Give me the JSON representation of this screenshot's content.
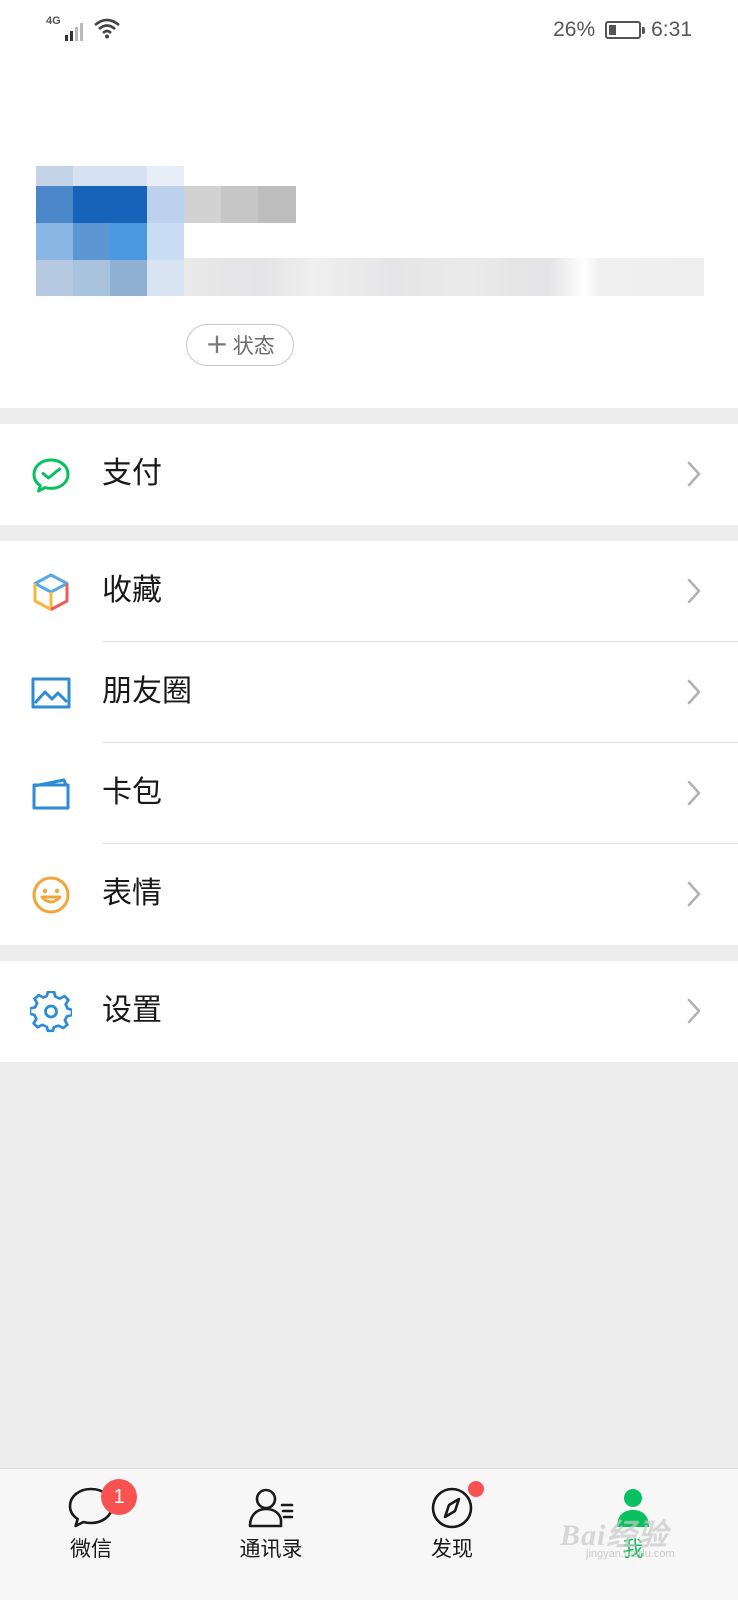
{
  "status_bar": {
    "network": "4G",
    "battery_percent": "26%",
    "battery_level": 0.26,
    "time": "6:31"
  },
  "profile": {
    "status_button_label": "状态",
    "status_button_plus": "+"
  },
  "menu": {
    "pay": {
      "label": "支付",
      "icon": "wechat-pay-icon"
    },
    "favorites": {
      "label": "收藏",
      "icon": "favorites-cube-icon"
    },
    "moments": {
      "label": "朋友圈",
      "icon": "moments-picture-icon"
    },
    "cards": {
      "label": "卡包",
      "icon": "card-wallet-icon"
    },
    "stickers": {
      "label": "表情",
      "icon": "smiley-icon"
    },
    "settings": {
      "label": "设置",
      "icon": "gear-icon"
    }
  },
  "tabbar": {
    "chats": {
      "label": "微信",
      "badge": "1",
      "icon": "chat-bubble-icon"
    },
    "contacts": {
      "label": "通讯录",
      "icon": "contacts-icon"
    },
    "discover": {
      "label": "发现",
      "icon": "compass-icon",
      "dot": true
    },
    "me": {
      "label": "我",
      "icon": "person-icon",
      "active": true
    }
  },
  "colors": {
    "accent_green": "#07c160",
    "badge_red": "#fa5151",
    "background": "#ededed"
  },
  "watermark": {
    "text": "Bai经验",
    "sub": "jingyan.baidu.com"
  }
}
